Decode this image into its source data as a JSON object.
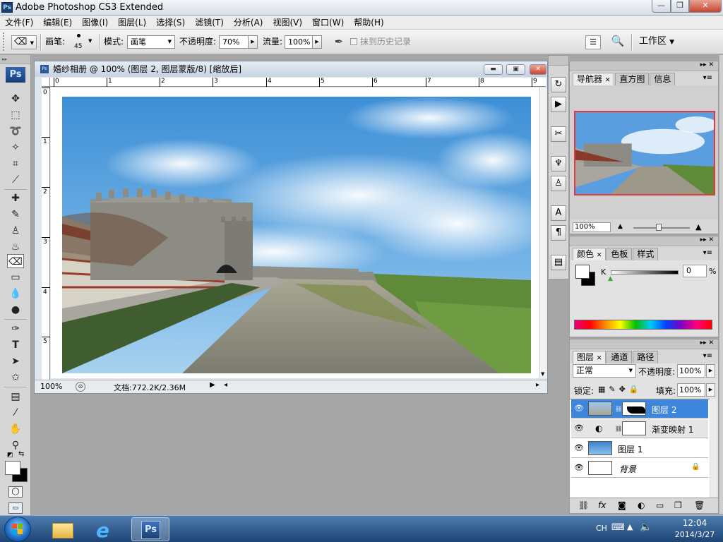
{
  "window": {
    "title": "Adobe Photoshop CS3 Extended",
    "app_badge": "Ps"
  },
  "menu": [
    "文件(F)",
    "编辑(E)",
    "图像(I)",
    "图层(L)",
    "选择(S)",
    "滤镜(T)",
    "分析(A)",
    "视图(V)",
    "窗口(W)",
    "帮助(H)"
  ],
  "options": {
    "brush_label": "画笔:",
    "brush_size": "45",
    "mode_label": "模式:",
    "mode_value": "画笔",
    "opacity_label": "不透明度:",
    "opacity_value": "70%",
    "flow_label": "流量:",
    "flow_value": "100%",
    "history_label": "抹到历史记录",
    "workspace_label": "工作区"
  },
  "tools": {
    "logo": "Ps"
  },
  "document": {
    "title": "婚纱相册 @ 100% (图层 2, 图层蒙版/8) [缩放后]",
    "zoom": "100%",
    "doc_info": "文档:772.2K/2.36M",
    "ruler_top": [
      "0",
      "1",
      "2",
      "3",
      "4",
      "5",
      "6",
      "7",
      "8",
      "9"
    ],
    "ruler_left": [
      "0",
      "1",
      "2",
      "3",
      "4",
      "5"
    ]
  },
  "navigator": {
    "tabs": [
      "导航器",
      "直方图",
      "信息"
    ],
    "zoom": "100%"
  },
  "color_panel": {
    "tabs": [
      "颜色",
      "色板",
      "样式"
    ],
    "channel": "K",
    "value": "0",
    "unit": "%"
  },
  "layers_panel": {
    "tabs": [
      "图层",
      "通道",
      "路径"
    ],
    "blend_mode": "正常",
    "opacity_label": "不透明度:",
    "opacity_value": "100%",
    "lock_label": "锁定:",
    "fill_label": "填充:",
    "fill_value": "100%",
    "layers": [
      {
        "name": "图层 2",
        "selected": true
      },
      {
        "name": "渐变映射 1",
        "selected": false
      },
      {
        "name": "图层 1",
        "selected": false
      },
      {
        "name": "背景",
        "selected": false
      }
    ]
  },
  "taskbar": {
    "lang": "CH",
    "time": "12:04",
    "date": "2014/3/27",
    "ps_badge": "Ps"
  },
  "colors": {
    "selected_layer": "#3d86dc",
    "ps_blue": "#1c3f72"
  }
}
